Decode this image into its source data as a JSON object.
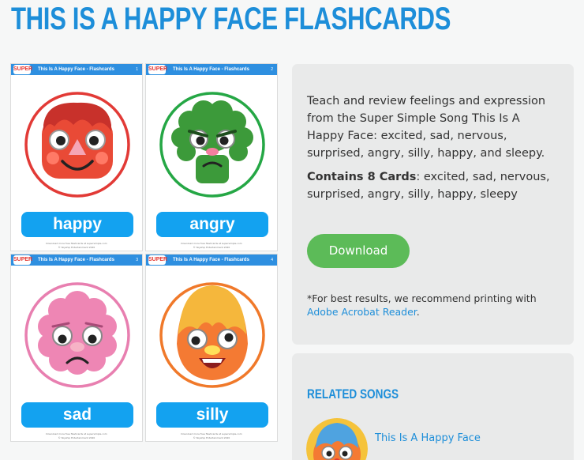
{
  "page": {
    "title": "THIS IS A HAPPY FACE FLASHCARDS"
  },
  "cards": [
    {
      "header": "This Is A Happy Face - Flashcards",
      "word": "happy",
      "face": "happy-face"
    },
    {
      "header": "This Is A Happy Face - Flashcards",
      "word": "angry",
      "face": "angry-face"
    },
    {
      "header": "This Is A Happy Face - Flashcards",
      "word": "sad",
      "face": "sad-face"
    },
    {
      "header": "This Is A Happy Face - Flashcards",
      "word": "silly",
      "face": "silly-face"
    }
  ],
  "card_common": {
    "logo": "SUPER",
    "footer_line1": "Download more free flashcards at supersimple.com",
    "footer_line2": "© Skyship Entertainment 2020"
  },
  "info": {
    "description": "Teach and review feelings and expression from the Super Simple Song This Is A Happy Face: excited, sad, nervous, surprised, angry, silly, happy, and sleepy.",
    "contains_label": "Contains 8 Cards",
    "contains_list": ": excited, sad, nervous, surprised, angry, silly, happy, sleepy",
    "download_label": "Download",
    "note_prefix": "*For best results, we recommend printing with ",
    "note_link": "Adobe Acrobat Reader",
    "note_suffix": "."
  },
  "related": {
    "title": "RELATED SONGS",
    "songs": [
      {
        "title": "This Is A Happy Face",
        "thumb_icon": "happy-face-thumbnail"
      }
    ]
  },
  "colors": {
    "accent_blue": "#1d8ed9",
    "download_green": "#5cbb58",
    "word_button_blue": "#13a2f0",
    "panel_gray": "#e9eaea"
  }
}
